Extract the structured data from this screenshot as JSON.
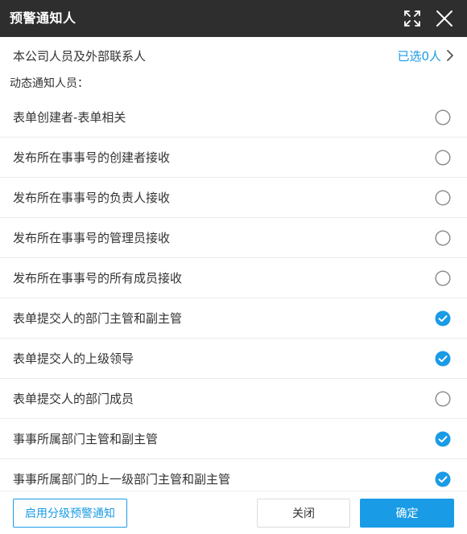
{
  "dialog": {
    "title": "预警通知人",
    "icons": {
      "expand": "expand-icon",
      "close": "close-icon"
    }
  },
  "contacts": {
    "label": "本公司人员及外部联系人",
    "selected_text": "已选0人",
    "chevron": "chevron-right-icon"
  },
  "dynamic_section": {
    "label": "动态通知人员："
  },
  "options": [
    {
      "label": "表单创建者-表单相关",
      "checked": false
    },
    {
      "label": "发布所在事事号的创建者接收",
      "checked": false
    },
    {
      "label": "发布所在事事号的负责人接收",
      "checked": false
    },
    {
      "label": "发布所在事事号的管理员接收",
      "checked": false
    },
    {
      "label": "发布所在事事号的所有成员接收",
      "checked": false
    },
    {
      "label": "表单提交人的部门主管和副主管",
      "checked": true
    },
    {
      "label": "表单提交人的上级领导",
      "checked": true
    },
    {
      "label": "表单提交人的部门成员",
      "checked": false
    },
    {
      "label": "事事所属部门主管和副主管",
      "checked": true
    },
    {
      "label": "事事所属部门的上一级部门主管和副主管",
      "checked": true
    }
  ],
  "footer": {
    "grade_label": "启用分级预警通知",
    "close_label": "关闭",
    "ok_label": "确定"
  },
  "colors": {
    "titlebar": "#2e2e2e",
    "accent": "#1a9be6",
    "unchecked": "#888888",
    "divider": "#ebebeb"
  }
}
